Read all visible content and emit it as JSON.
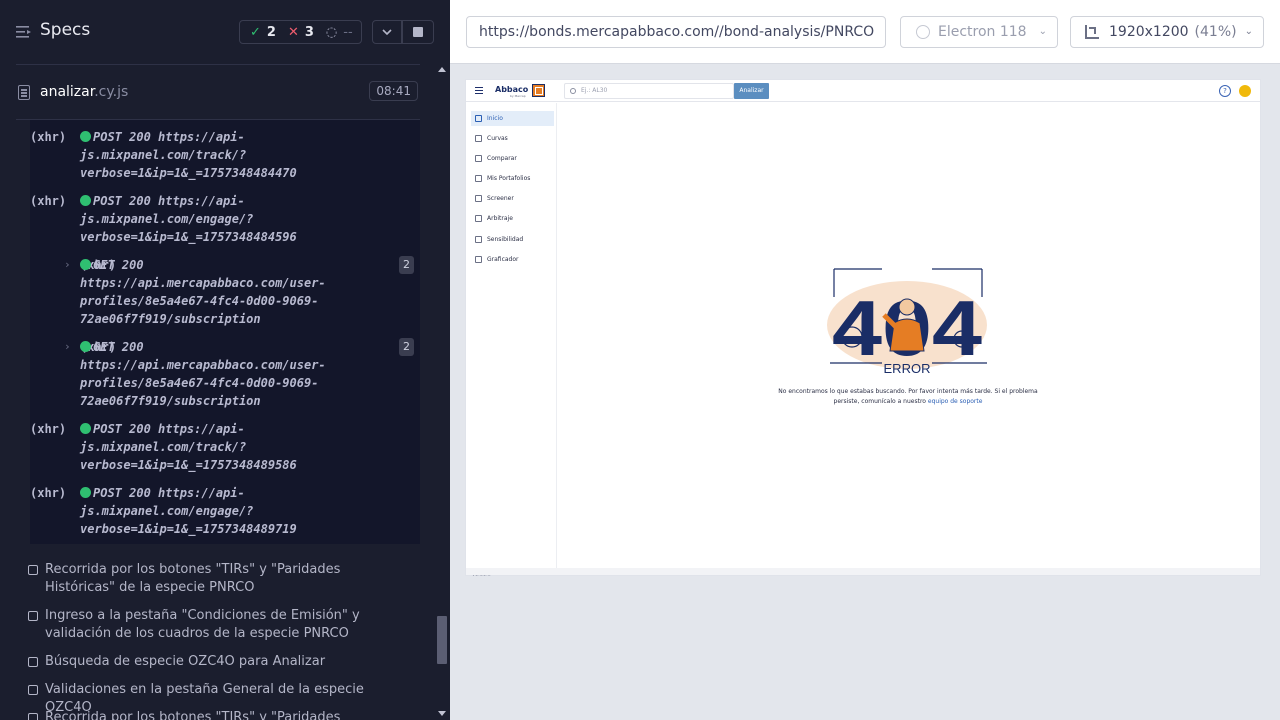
{
  "runner": {
    "title": "Specs",
    "stats": {
      "passed": "2",
      "failed": "3",
      "pending": "--"
    },
    "spec": {
      "name": "analizar",
      "ext": ".cy.js",
      "duration": "08:41"
    },
    "log": [
      {
        "type": "(xhr)",
        "msg": "POST 200 https://api-js.mixpanel.com/track/?verbose=1&ip=1&_=1757348484470",
        "count": ""
      },
      {
        "type": "(xhr)",
        "msg": "POST 200 https://api-js.mixpanel.com/engage/?verbose=1&ip=1&_=1757348484596",
        "count": ""
      },
      {
        "type": "(xhr)",
        "msg": "GET 200 https://api.mercapabbaco.com/user-profiles/8e5a4e67-4fc4-0d00-9069-72ae06f7f919/subscription",
        "count": "2"
      },
      {
        "type": "(xhr)",
        "msg": "GET 200 https://api.mercapabbaco.com/user-profiles/8e5a4e67-4fc4-0d00-9069-72ae06f7f919/subscription",
        "count": "2"
      },
      {
        "type": "(xhr)",
        "msg": "POST 200 https://api-js.mixpanel.com/track/?verbose=1&ip=1&_=1757348489586",
        "count": ""
      },
      {
        "type": "(xhr)",
        "msg": "POST 200 https://api-js.mixpanel.com/engage/?verbose=1&ip=1&_=1757348489719",
        "count": ""
      }
    ],
    "tests": [
      "Recorrida por los botones \"TIRs\" y \"Paridades Históricas\" de la especie PNRCO",
      "Ingreso a la pestaña \"Condiciones de Emisión\" y validación de los cuadros de la especie PNRCO",
      "Búsqueda de especie OZC4O para Analizar",
      "Validaciones en la pestaña General de la especie OZC4O",
      "Recorrida por los botones \"TIRs\" y \"Paridades Históricas\""
    ]
  },
  "aut": {
    "url": "https://bonds.mercapabbaco.com//bond-analysis/PNRCO",
    "browser": "Electron 118",
    "viewport": "1920x1200",
    "zoom": "(41%)"
  },
  "app": {
    "logo": "Abbaco",
    "logo_sub": "by Mercap",
    "search_placeholder": "Ej.: AL30",
    "analyze_button": "Analizar",
    "help": "?",
    "nav": [
      "Inicio",
      "Curvas",
      "Comparar",
      "Mis Portafolios",
      "Screener",
      "Arbitraje",
      "Sensibilidad",
      "Graficador"
    ],
    "version": "v1.31.0",
    "error_code": "404",
    "error_label": "ERROR",
    "error_msg": "No encontramos lo que estabas buscando. Por favor intenta más tarde. Si el problema persiste, comunícalo a nuestro",
    "error_link": "equipo de soporte"
  },
  "colors": {
    "runner_bg": "#1b1e2e",
    "pass": "#2fbf71",
    "fail": "#ef5d6e",
    "brand_navy": "#1a2d66",
    "brand_orange": "#e57d24"
  }
}
